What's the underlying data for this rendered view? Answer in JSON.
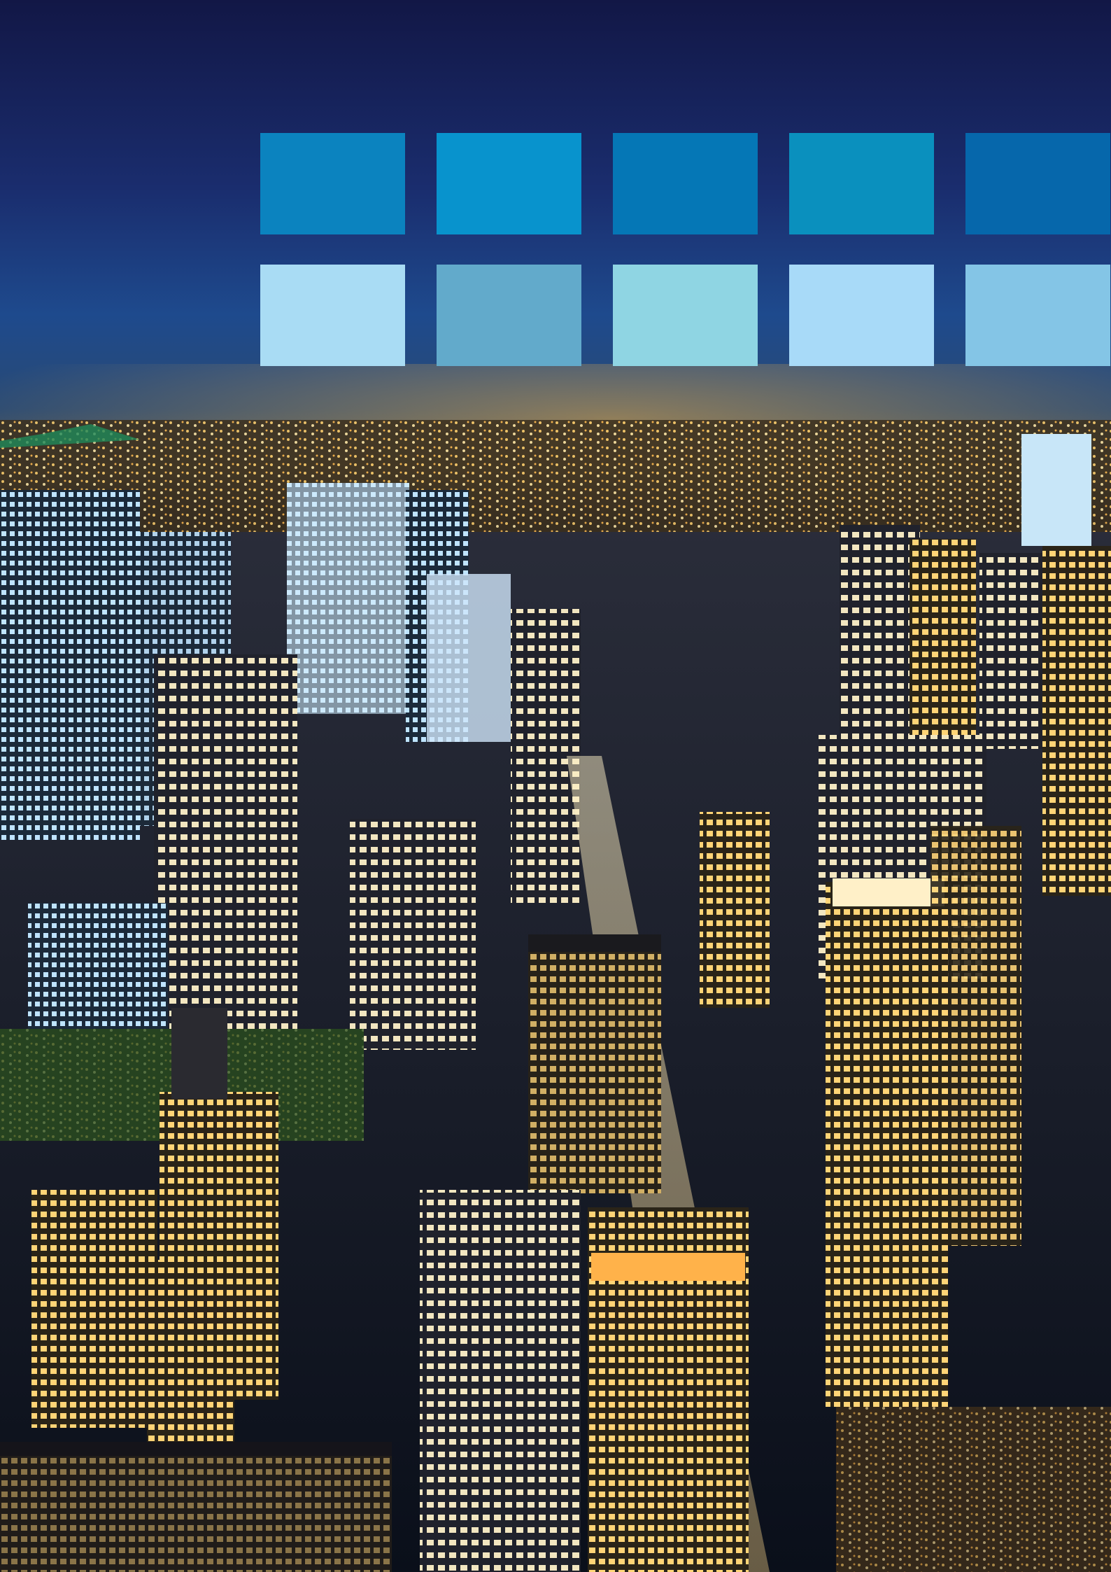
{
  "scene": {
    "description_colors": {
      "sky_top": "#141a4a",
      "sky_mid": "#1c3f86",
      "horizon_glow": "#d8a23a",
      "city_dark": "#0c1320",
      "window_warm": "#ffd878",
      "window_cool": "#b7e3ff"
    }
  },
  "swatches": {
    "row_top": [
      {
        "color": "#0b83bf"
      },
      {
        "color": "#0893cd"
      },
      {
        "color": "#0577b6"
      },
      {
        "color": "#0a90be"
      },
      {
        "color": "#0667ab"
      }
    ],
    "row_bottom": [
      {
        "color": "#a9dcf4"
      },
      {
        "color": "#62aacb"
      },
      {
        "color": "#8fd5e3"
      },
      {
        "color": "#a8daf8"
      },
      {
        "color": "#84c5e6"
      }
    ]
  }
}
